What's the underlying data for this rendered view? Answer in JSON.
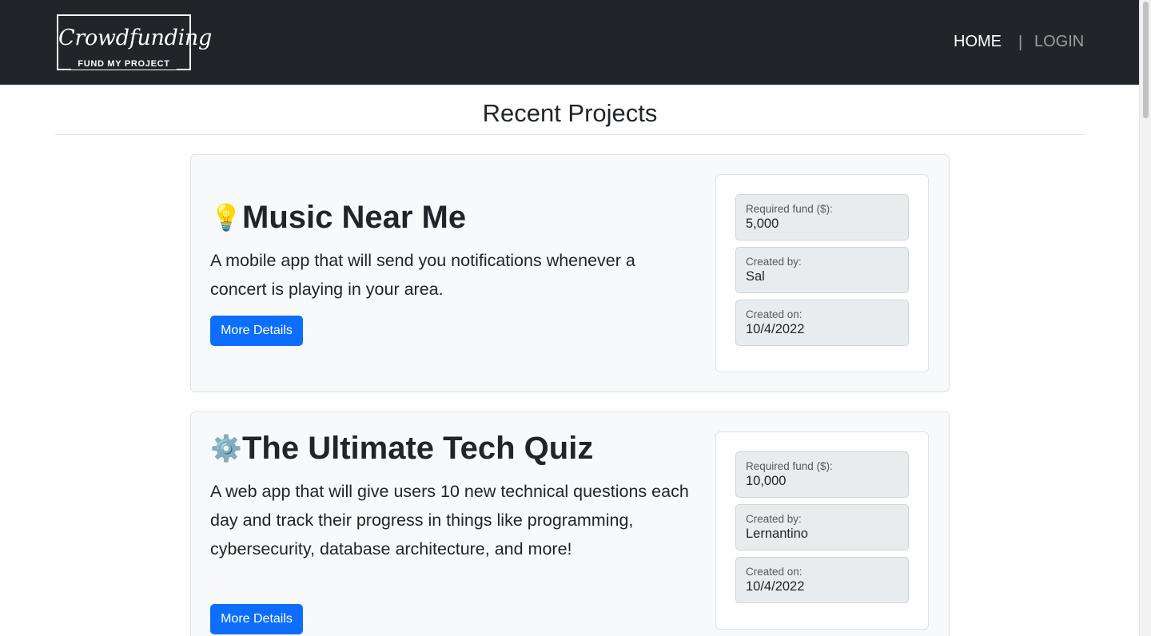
{
  "navbar": {
    "logo_script": "Crowdfunding",
    "logo_sub": "FUND MY PROJECT",
    "home_label": "HOME",
    "separator": "|",
    "login_label": "LOGIN"
  },
  "page_title": "Recent Projects",
  "projects": [
    {
      "icon": "💡",
      "icon_name": "lightbulb-icon",
      "title": "Music Near Me",
      "description": "A mobile app that will send you notifications whenever a concert is playing in your area.",
      "button_label": "More Details",
      "required_fund_label": "Required fund ($):",
      "required_fund": "5,000",
      "created_by_label": "Created by:",
      "created_by": "Sal",
      "created_on_label": "Created on:",
      "created_on": "10/4/2022"
    },
    {
      "icon": "⚙️",
      "icon_name": "gear-icon",
      "title": "The Ultimate Tech Quiz",
      "description": "A web app that will give users 10 new technical questions each day and track their progress in things like programming, cybersecurity, database architecture, and more!",
      "button_label": "More Details",
      "required_fund_label": "Required fund ($):",
      "required_fund": "10,000",
      "created_by_label": "Created by:",
      "created_by": "Lernantino",
      "created_on_label": "Created on:",
      "created_on": "10/4/2022"
    }
  ],
  "colors": {
    "navbar_bg": "#212529",
    "primary_button": "#0d6efd",
    "card_bg": "#f8f9fa",
    "info_box_bg": "#e9ecef"
  }
}
